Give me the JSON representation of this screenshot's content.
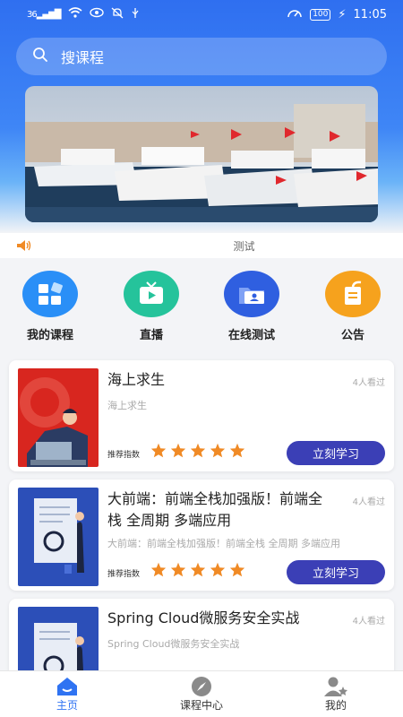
{
  "status": {
    "network": "36",
    "battery": "100",
    "time": "11:05"
  },
  "search": {
    "placeholder": "搜课程"
  },
  "notice": {
    "text": "测试"
  },
  "menu": [
    {
      "label": "我的课程",
      "icon": "grid-icon",
      "color": "#2a8ff7"
    },
    {
      "label": "直播",
      "icon": "tv-icon",
      "color": "#25c39b"
    },
    {
      "label": "在线测试",
      "icon": "folder-user-icon",
      "color": "#2f5fe0"
    },
    {
      "label": "公告",
      "icon": "notice-icon",
      "color": "#f6a21d"
    }
  ],
  "courses": [
    {
      "title": "海上求生",
      "views": "4人看过",
      "subtitle": "海上求生",
      "rec_label": "推荐指数",
      "rating": 5,
      "button": "立刻学习"
    },
    {
      "title": "大前端：前端全栈加强版！前端全栈 全周期 多端应用",
      "views": "4人看过",
      "subtitle": "大前端：前端全栈加强版！前端全栈 全周期 多端应用",
      "rec_label": "推荐指数",
      "rating": 5,
      "button": "立刻学习"
    },
    {
      "title": "Spring Cloud微服务安全实战",
      "views": "4人看过",
      "subtitle": "Spring Cloud微服务安全实战"
    }
  ],
  "tabs": [
    {
      "label": "主页",
      "icon": "home-icon",
      "active": true
    },
    {
      "label": "课程中心",
      "icon": "compass-icon",
      "active": false
    },
    {
      "label": "我的",
      "icon": "user-star-icon",
      "active": false
    }
  ],
  "colors": {
    "primary": "#2f73f2",
    "button": "#3b3fb6",
    "star": "#f08a25"
  }
}
